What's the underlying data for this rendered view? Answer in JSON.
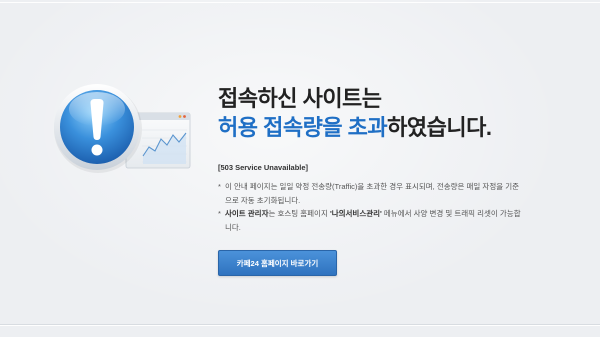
{
  "colors": {
    "background": "#edeff2",
    "title_text": "#222222",
    "highlight": "#1f6fc5",
    "body_text": "#555555",
    "button": "#2f73bf"
  },
  "illustration": {
    "primary_icon": "exclamation-circle-icon",
    "secondary_icon": "browser-window-chart-icon"
  },
  "title": {
    "line1": "접속하신 사이트는",
    "line2_highlight": "허용 접속량을 초과",
    "line2_rest": "하였습니다."
  },
  "status": "[503 Service Unavailable]",
  "notices": [
    {
      "bullet": "*",
      "lines": [
        "이 안내 페이지는 일일 약정 전송량(Traffic)을 초과한 경우 표시되며, 전송량은 매일 자정을 기준",
        "으로 자동 초기화됩니다."
      ]
    },
    {
      "bullet": "*",
      "lines": [
        [
          "사이트 관리자",
          "는 호스팅 홈페이지 ",
          "'나의서비스관리'",
          " 메뉴에서 사양 변경 및 트래픽 리셋이 가능합"
        ],
        "니다."
      ]
    }
  ],
  "button": {
    "label": "카페24 홈페이지 바로가기"
  }
}
